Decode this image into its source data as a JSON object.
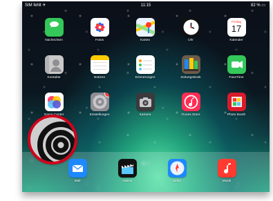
{
  "status_bar": {
    "carrier": "SIM fehlt ✈",
    "time": "11:15",
    "battery": "82 % ▭"
  },
  "home": {
    "apps": [
      {
        "label": "Nachrichten",
        "icon": "messages-icon",
        "color": "#34c759"
      },
      {
        "label": "Fotos",
        "icon": "photos-icon",
        "color": "#ffffff"
      },
      {
        "label": "Karten",
        "icon": "maps-icon",
        "color": "#f4f4f4"
      },
      {
        "label": "Uhr",
        "icon": "clock-icon",
        "color": "#111111"
      },
      {
        "label": "Kalender",
        "icon": "calendar-icon",
        "color": "#ffffff",
        "day": "Freitag",
        "date": "17"
      },
      {
        "label": "Kontakte",
        "icon": "contacts-icon",
        "color": "#c9c9c9"
      },
      {
        "label": "Notizen",
        "icon": "notes-icon",
        "color": "#ffffff"
      },
      {
        "label": "Erinnerungen",
        "icon": "reminders-icon",
        "color": "#ffffff"
      },
      {
        "label": "Zeitungskiosk",
        "icon": "newsstand-icon",
        "color": "#6b5b4b"
      },
      {
        "label": "FaceTime",
        "icon": "facetime-icon",
        "color": "#34c759"
      },
      {
        "label": "Game Center",
        "icon": "game-center-icon",
        "color": "#ffffff"
      },
      {
        "label": "Einstellungen",
        "icon": "settings-icon",
        "color": "#8e8e93",
        "badge": "1"
      },
      {
        "label": "Kamera",
        "icon": "camera-icon",
        "color": "#3a3a3c"
      },
      {
        "label": "iTunes Store",
        "icon": "itunes-store-icon",
        "color": "#ff2d55"
      },
      {
        "label": "Photo Booth",
        "icon": "photo-booth-icon",
        "color": "#d81b2b"
      }
    ],
    "page_indicator": {
      "pages": 2,
      "active_index": 0
    }
  },
  "dock": {
    "apps": [
      {
        "label": "Mail",
        "icon": "mail-icon",
        "color": "#1e88ff"
      },
      {
        "label": "Videos",
        "icon": "videos-icon",
        "color": "#111111"
      },
      {
        "label": "Safari",
        "icon": "safari-icon",
        "color": "#1e88ff"
      },
      {
        "label": "Musik",
        "icon": "music-icon",
        "color": "#ff3b30"
      }
    ]
  },
  "assistive_touch": {
    "icon": "assistive-touch-icon",
    "border_color": "#d0021b"
  }
}
